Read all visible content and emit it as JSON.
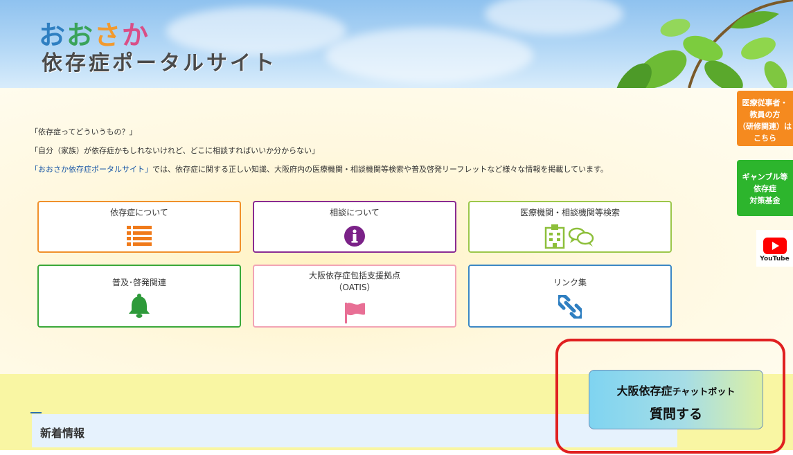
{
  "header": {
    "logo_top": [
      "お",
      "お",
      "さ",
      "か"
    ],
    "logo_bottom": "依存症ポータルサイト"
  },
  "intro": {
    "line1": "「依存症ってどういうもの？」",
    "line2": "「自分（家族）が依存症かもしれないけれど、どこに相談すればいいか分からない」",
    "site_name": "「おおさか依存症ポータルサイト」",
    "line3_rest": "では、依存症に関する正しい知識、大阪府内の医療機関・相談機関等検索や普及啓発リーフレットなど様々な情報を掲載しています。"
  },
  "cards": [
    {
      "label": "依存症について",
      "icon": "list-icon",
      "border": "#f0902a"
    },
    {
      "label": "相談について",
      "icon": "info-icon",
      "border": "#8a2b92"
    },
    {
      "label": "医療機関・相談機関等検索",
      "icon": "hospital-chat-icon",
      "border": "#9cc74a"
    },
    {
      "label": "普及･啓発関連",
      "icon": "bell-icon",
      "border": "#3aa83a"
    },
    {
      "label": "大阪依存症包括支援拠点",
      "label2": "（OATIS）",
      "icon": "flag-icon",
      "border": "#f2a3b5"
    },
    {
      "label": "リンク集",
      "icon": "link-icon",
      "border": "#3b87c5"
    }
  ],
  "side_tabs": {
    "medical": [
      "医療従事者・",
      "教員の方",
      "（研修関連）は",
      "こちら"
    ],
    "gamble": [
      "ギャンブル等",
      "依存症",
      "対策基金"
    ],
    "youtube": "YouTube"
  },
  "news": {
    "title": "新着情報"
  },
  "chatbot": {
    "title_main": "大阪依存症",
    "title_small": "チャットボット",
    "action": "質問する"
  },
  "colors": {
    "accent_orange": "#f58a1f",
    "accent_green": "#2db52d",
    "highlight_red": "#e02020"
  }
}
